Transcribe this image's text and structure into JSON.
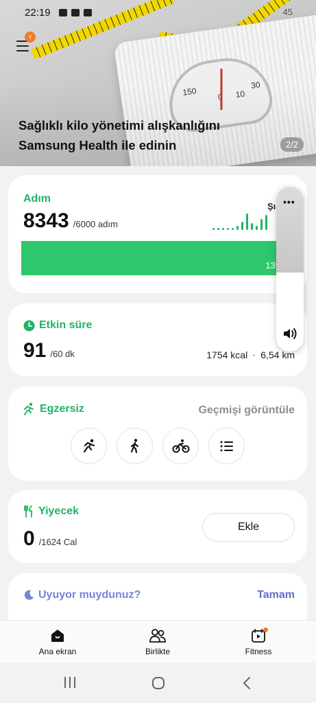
{
  "status_bar": {
    "time": "22:19",
    "right_text": "45"
  },
  "banner": {
    "menu_badge": "Y",
    "title_line1": "Sağlıklı kilo yönetimi alışkanlığını",
    "title_line2": "Samsung Health ile edinin",
    "page_indicator": "2/2",
    "dial_numbers": [
      "150",
      "0",
      "10",
      "30"
    ]
  },
  "steps": {
    "title": "Adım",
    "value": "8343",
    "goal": "/6000 adım",
    "spark_label": "Şı",
    "bar_text": "139",
    "progress_fraction": 1.0
  },
  "active_time": {
    "title": "Etkin süre",
    "value": "91",
    "goal": "/60 dk",
    "calories": "1754 kcal",
    "distance": "6,54 km"
  },
  "exercise": {
    "title": "Egzersiz",
    "history_link": "Geçmişi görüntüle",
    "buttons": [
      "running-icon",
      "walking-icon",
      "cycling-icon",
      "list-icon"
    ]
  },
  "food": {
    "title": "Yiyecek",
    "value": "0",
    "goal": "/1624 Cal",
    "add_label": "Ekle"
  },
  "sleep": {
    "title": "Uyuyor muydunuz?",
    "action": "Tamam"
  },
  "volume": {
    "more_label": "•••",
    "level_fraction": 0.48
  },
  "bottom_nav": [
    {
      "label": "Ana ekran",
      "icon": "home-icon",
      "active": true
    },
    {
      "label": "Birlikte",
      "icon": "people-icon",
      "active": false
    },
    {
      "label": "Fitness",
      "icon": "fitness-icon",
      "active": false,
      "badge": true
    }
  ],
  "colors": {
    "accent_green": "#20b366",
    "bar_green": "#2fc76c",
    "sleep_blue": "#5e70cf",
    "badge_orange": "#f47a2e"
  }
}
